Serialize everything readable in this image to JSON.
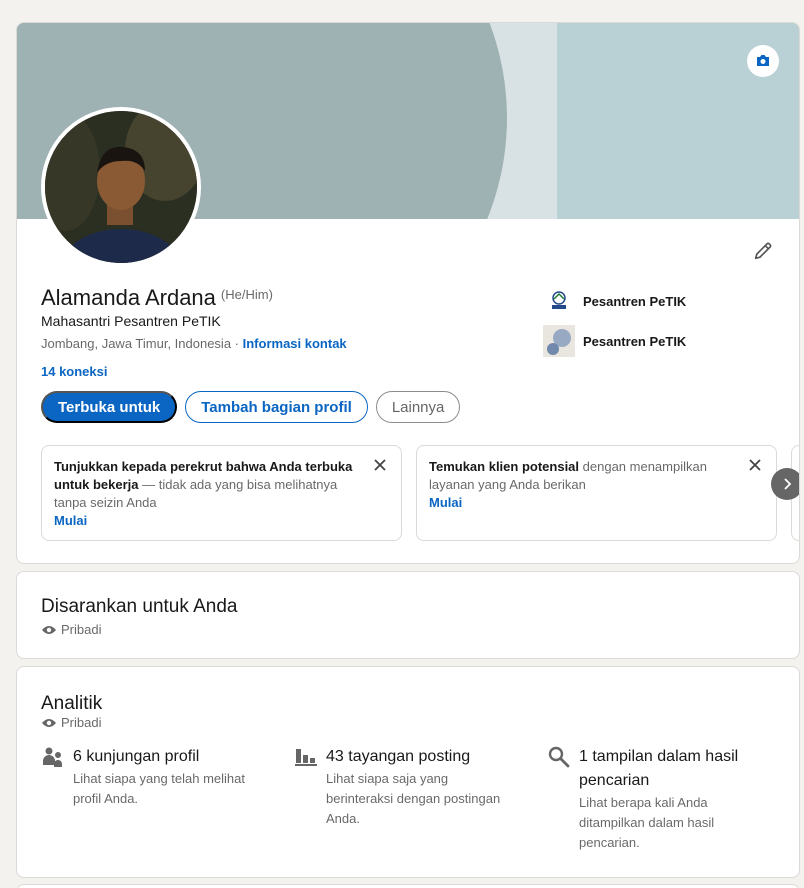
{
  "profile": {
    "name": "Alamanda Ardana",
    "pronouns": "(He/Him)",
    "headline": "Mahasantri Pesantren PeTIK",
    "location": "Jombang, Jawa Timur, Indonesia",
    "separator": " · ",
    "contact_link": "Informasi kontak",
    "connections": "14 koneksi",
    "avatar_icon": "profile-photo",
    "camera_icon": "camera-icon",
    "edit_icon": "pencil-icon"
  },
  "organizations": [
    {
      "name": "Pesantren PeTIK",
      "logo": "petik-logo"
    },
    {
      "name": "Pesantren PeTIK",
      "logo": "school-logo"
    }
  ],
  "buttons": {
    "open_to": "Terbuka untuk",
    "add_section": "Tambah bagian profil",
    "more": "Lainnya"
  },
  "suggestions": [
    {
      "bold": "Tunjukkan kepada perekrut bahwa Anda terbuka untuk bekerja",
      "rest": " — tidak ada yang bisa melihatnya tanpa seizin Anda",
      "cta": "Mulai"
    },
    {
      "bold": "Temukan klien potensial",
      "rest": " dengan menampilkan layanan yang Anda berikan",
      "cta": "Mulai"
    }
  ],
  "suggested_section": {
    "title": "Disarankan untuk Anda",
    "visibility": "Pribadi"
  },
  "analytics": {
    "title": "Analitik",
    "visibility": "Pribadi",
    "metrics": [
      {
        "icon": "people-icon",
        "title": "6 kunjungan profil",
        "desc": "Lihat siapa yang telah melihat profil Anda."
      },
      {
        "icon": "bar-chart-icon",
        "title": "43 tayangan posting",
        "desc": "Lihat siapa saja yang berinteraksi dengan postingan Anda."
      },
      {
        "icon": "search-icon",
        "title": "1 tampilan dalam hasil pencarian",
        "desc": "Lihat berapa kali Anda ditampilkan dalam hasil pencarian."
      }
    ]
  },
  "colors": {
    "accent": "#0a66c2",
    "banner": "#b9d0d5",
    "banner_dark": "#9eb1b3",
    "background": "#f3f2ef"
  }
}
